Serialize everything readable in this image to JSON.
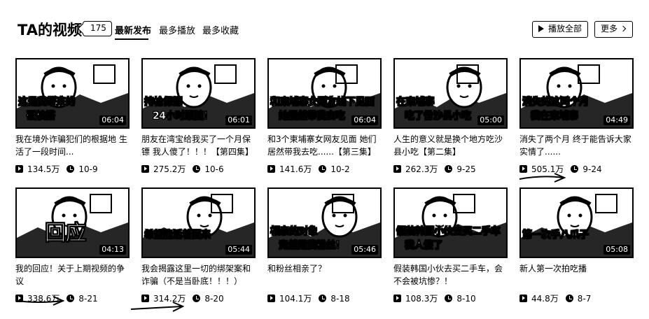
{
  "header": {
    "title": "TA的视频",
    "count": "175",
    "tabs": [
      "最新发布",
      "最多播放",
      "最多收藏"
    ],
    "play_all": "播放全部",
    "more": "更多"
  },
  "videos": [
    {
      "caption": "这是我带来的",
      "caption2": "硬核搭",
      "duration": "06:04",
      "title": "我在境外诈骗犯们的根据地 生活了一段时间...",
      "views": "134.5万",
      "date": "10-9"
    },
    {
      "caption": "持枪保镖",
      "caption2": "24小时跟随！",
      "duration": "06:01",
      "title": "朋友在湾宝给我买了一个月保镖 我人傻了！！！【第四集】",
      "views": "275.2万",
      "date": "10-6"
    },
    {
      "caption": "和柬埔寨女网友线下见面",
      "caption2": "她居然带我去吃",
      "duration": "06:04",
      "title": "和3个柬埔寨女网友见面 她们居然带我去吃......【第三集】",
      "views": "141.6万",
      "date": "10-2"
    },
    {
      "caption": "在柬埔寨",
      "caption2": "吃了份沙县小吃",
      "duration": "05:00",
      "title": "人生的意义就是换个地方吃沙县小吃【第二集】",
      "views": "262.3万",
      "date": "9-25"
    },
    {
      "caption": "消失的这两个月",
      "caption2": "我在柬埔寨",
      "duration": "04:49",
      "title": "消失了两个月 终于能告诉大家实情了......",
      "views": "505.1万",
      "date": "9-24"
    },
    {
      "caption": "回应",
      "caption2": "",
      "duration": "04:13",
      "title": "我的回应！关于上期视频的争议",
      "views": "338.6万",
      "date": "8-21"
    },
    {
      "caption": "希望能活着回来",
      "caption2": "",
      "duration": "05:44",
      "title": "我会揭露这里一切的绑架案和诈骗（不是当卧底！！！）",
      "views": "314.2万",
      "date": "8-20"
    },
    {
      "caption": "相亲的对象",
      "caption2": "竟然是我粉丝！",
      "duration": "05:46",
      "title": "和粉丝相亲了？",
      "views": "104.1万",
      "date": "8-18"
    },
    {
      "caption": "假装韩国小伙去买二手车",
      "caption2": "我人傻了",
      "duration": "",
      "title": "假装韩国小伙去买二手车，会不会被坑惨？！",
      "views": "108.3万",
      "date": "8-10"
    },
    {
      "caption": "第一次手八爪子",
      "caption2": "",
      "duration": "05:08",
      "title": "新人第一次拍吃播",
      "views": "44.8万",
      "date": "8-7"
    }
  ]
}
